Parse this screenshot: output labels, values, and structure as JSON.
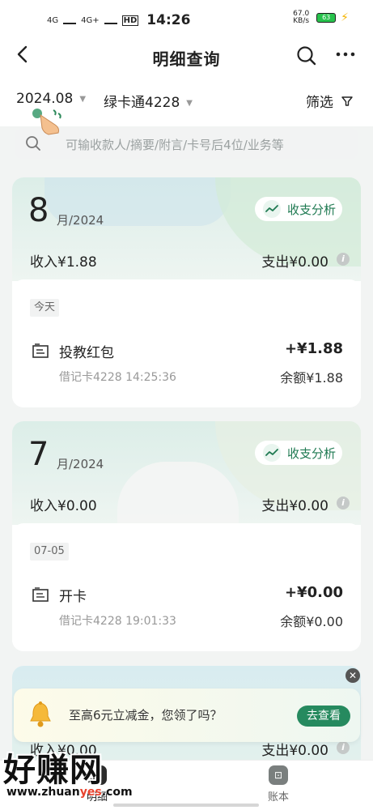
{
  "status_bar": {
    "time": "14:26",
    "net1": "4G",
    "net2": "4G+",
    "hd": "HD",
    "speed": "67.0 KB/s",
    "battery": "63"
  },
  "header": {
    "title": "明细查询"
  },
  "filters": {
    "date": "2024.08",
    "card": "绿卡通4228",
    "filter_label": "筛选"
  },
  "search": {
    "placeholder": "可输收款人/摘要/附言/卡号后4位/业务等"
  },
  "months": [
    {
      "month": "8",
      "year_label": "月/2024",
      "analysis_label": "收支分析",
      "income": "收入¥1.88",
      "expense": "支出¥0.00",
      "day_label": "今天",
      "transaction": {
        "name": "投教红包",
        "amount": "+¥1.88",
        "detail": "借记卡4228 14:25:36",
        "balance": "余额¥1.88"
      }
    },
    {
      "month": "7",
      "year_label": "月/2024",
      "analysis_label": "收支分析",
      "income": "收入¥0.00",
      "expense": "支出¥0.00",
      "day_label": "07-05",
      "transaction": {
        "name": "开卡",
        "amount": "+¥0.00",
        "detail": "借记卡4228 19:01:33",
        "balance": "余额¥0.00"
      }
    },
    {
      "income": "收入¥0.00",
      "expense": "支出¥0.00"
    }
  ],
  "promo": {
    "text": "至高6元立减金，您领了吗？",
    "button": "去查看"
  },
  "tabs": [
    {
      "label": "明细",
      "active": true
    },
    {
      "label": "账本",
      "active": false
    }
  ],
  "watermark": {
    "title": "好赚网",
    "url_prefix": "www.zhuan",
    "url_highlight": "yes",
    "url_suffix": ".com"
  },
  "colors": {
    "brand_green": "#268a5f",
    "accent_text": "#1f7a52"
  }
}
